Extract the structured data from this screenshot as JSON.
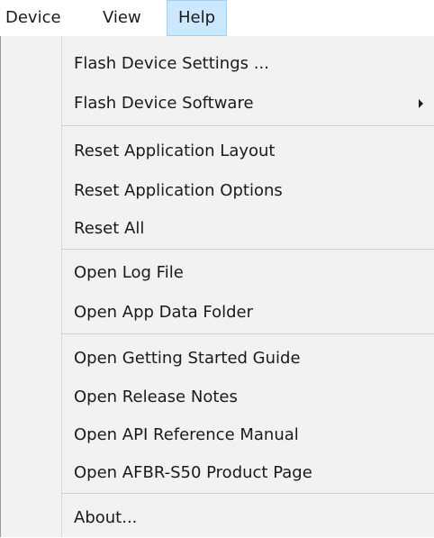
{
  "menubar": {
    "items": [
      {
        "label": "Device"
      },
      {
        "label": "View"
      },
      {
        "label": "Help"
      }
    ]
  },
  "dropdown": {
    "items": [
      {
        "label": "Flash Device Settings ..."
      },
      {
        "label": "Flash Device Software",
        "submenu_icon": "chevron-right-icon"
      },
      {
        "label": "Reset Application Layout"
      },
      {
        "label": "Reset Application Options"
      },
      {
        "label": "Reset All"
      },
      {
        "label": "Open Log File"
      },
      {
        "label": "Open App Data Folder"
      },
      {
        "label": "Open Getting Started Guide"
      },
      {
        "label": "Open Release Notes"
      },
      {
        "label": "Open API Reference Manual"
      },
      {
        "label": "Open AFBR-S50 Product Page"
      },
      {
        "label": "About..."
      }
    ]
  },
  "colors": {
    "selected_menubar_bg": "#cce8ff",
    "selected_menubar_border": "#99d1ff",
    "menu_bg": "#f2f2f2",
    "separator": "#d0d0d0"
  }
}
